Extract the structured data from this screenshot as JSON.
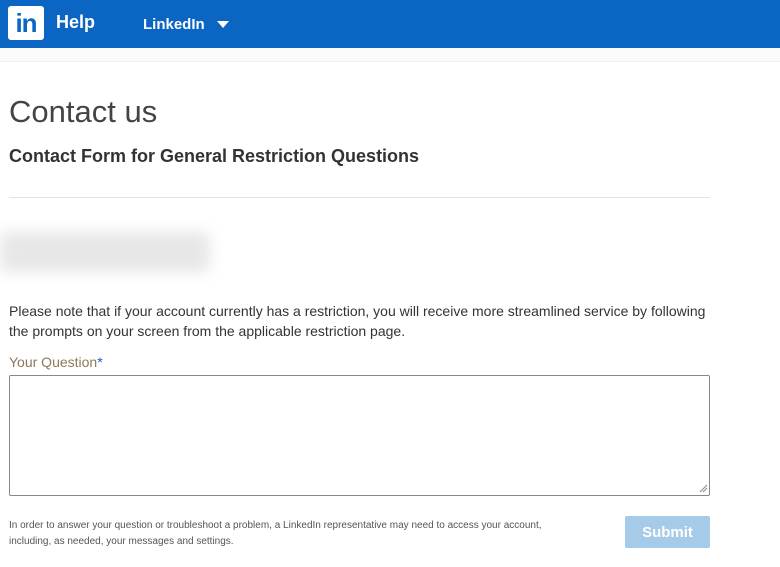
{
  "header": {
    "logo_text": "in",
    "title": "Help",
    "product_selector": {
      "label": "LinkedIn",
      "icon": "caret-down-icon"
    },
    "background_color": "#0a66c2"
  },
  "main": {
    "page_title": "Contact us",
    "form_title": "Contact Form for General Restriction Questions",
    "notice": "Please note that if your account currently has a restriction, you will receive more streamlined service by following the prompts on your screen from the applicable restriction page.",
    "question": {
      "label": "Your Question",
      "required_marker": "*",
      "value": ""
    },
    "disclaimer": "In order to answer your question or troubleshoot a problem, a LinkedIn representative may need to access your account, including, as needed, your messages and settings.",
    "submit_label": "Submit",
    "submit_color": "#a6cbe8"
  }
}
